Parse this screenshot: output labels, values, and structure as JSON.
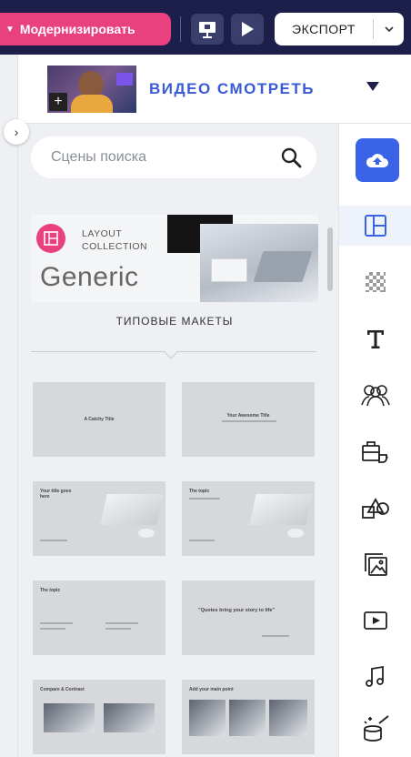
{
  "topbar": {
    "upgrade_label": "Модернизировать",
    "export_label": "ЭКСПОРТ",
    "upgrade_color": "#e8417e",
    "bg_color": "#1c1f4a"
  },
  "header": {
    "video_title": "ВИДЕО СМОТРЕТЬ",
    "title_color": "#3a5bd8"
  },
  "search": {
    "placeholder": "Сцены поиска"
  },
  "banner": {
    "line1": "LAYOUT",
    "line2": "COLLECTION",
    "title": "Generic"
  },
  "section": {
    "label": "ТИПОВЫЕ МАКЕТЫ"
  },
  "tiles": [
    {
      "title": "A Catchy Title"
    },
    {
      "title": "Your Awesome Title"
    },
    {
      "title": "Your title goes here"
    },
    {
      "title": "The topic"
    },
    {
      "title": "The topic"
    },
    {
      "title": "\"Quotes bring your story to life\""
    },
    {
      "title": "Compare & Contrast"
    },
    {
      "title": "Add your main point"
    }
  ],
  "rail": {
    "primary_color": "#3a63e8",
    "icons": [
      "upload-icon",
      "layout-icon",
      "background-icon",
      "text-icon",
      "characters-icon",
      "props-icon",
      "shapes-icon",
      "images-icon",
      "video-icon",
      "music-icon",
      "effects-icon"
    ]
  }
}
